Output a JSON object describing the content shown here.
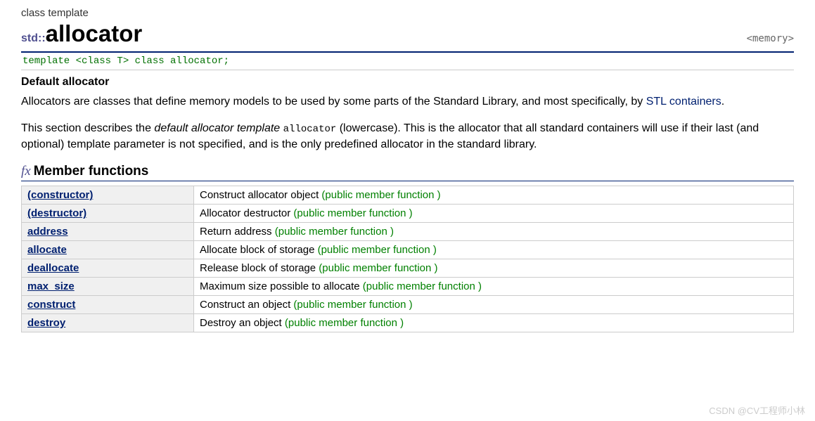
{
  "kind": "class template",
  "namespace": "std::",
  "name": "allocator",
  "header": "<memory>",
  "declaration": "template <class T> class allocator;",
  "subtitle": "Default allocator",
  "para1_a": "Allocators are classes that define memory models to be used by some parts of the Standard Library, and most specifically, by ",
  "para1_link": "STL containers",
  "para1_b": ".",
  "para2_a": "This section describes the ",
  "para2_italic": "default allocator template",
  "para2_space": " ",
  "para2_code": "allocator",
  "para2_b": " (lowercase). This is the allocator that all standard containers will use if their last (and optional) template parameter is not specified, and is the only predefined allocator in the standard library.",
  "members_heading": "Member functions",
  "annotation": "(public member function )",
  "members": [
    {
      "name": "(constructor)",
      "desc": "Construct allocator object"
    },
    {
      "name": "(destructor)",
      "desc": "Allocator destructor"
    },
    {
      "name": "address",
      "desc": "Return address"
    },
    {
      "name": "allocate",
      "desc": "Allocate block of storage"
    },
    {
      "name": "deallocate",
      "desc": "Release block of storage"
    },
    {
      "name": "max_size",
      "desc": "Maximum size possible to allocate"
    },
    {
      "name": "construct",
      "desc": "Construct an object"
    },
    {
      "name": "destroy",
      "desc": "Destroy an object"
    }
  ],
  "watermark": "CSDN @CV工程师小林"
}
